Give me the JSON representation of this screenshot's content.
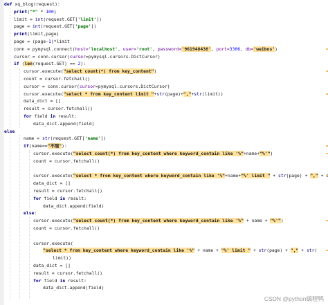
{
  "colors": {
    "background": "#ffffff",
    "keyword": "#000080",
    "string": "#007000",
    "number": "#0000ff",
    "highlight_box": "#ffe19c",
    "line_highlight": "#fffbe0",
    "watermark": "#9a9a9a"
  },
  "watermark": "CSDN @python编程鸭",
  "lines": [
    {
      "indent": 0,
      "tokens": [
        {
          "t": "def ",
          "c": "kw"
        },
        {
          "t": "xq_blog",
          "c": "fn"
        },
        {
          "t": "(request):",
          "c": "plain"
        }
      ]
    },
    {
      "indent": 1,
      "tokens": [
        {
          "t": "print",
          "c": "kw"
        },
        {
          "t": "(",
          "c": "plain"
        },
        {
          "t": "\"*\"",
          "c": "str"
        },
        {
          "t": " * ",
          "c": "plain"
        },
        {
          "t": "100",
          "c": "num"
        },
        {
          "t": ")",
          "c": "plain"
        }
      ]
    },
    {
      "indent": 1,
      "tokens": [
        {
          "t": "limit = ",
          "c": "plain"
        },
        {
          "t": "int",
          "c": "bi"
        },
        {
          "t": "(request.GET[",
          "c": "plain"
        },
        {
          "t": "'limit'",
          "c": "str"
        },
        {
          "t": "])",
          "c": "plain"
        }
      ]
    },
    {
      "indent": 1,
      "tokens": [
        {
          "t": "page = ",
          "c": "plain"
        },
        {
          "t": "int",
          "c": "bi"
        },
        {
          "t": "(request.GET[",
          "c": "plain"
        },
        {
          "t": "'page'",
          "c": "str"
        },
        {
          "t": "])",
          "c": "plain"
        }
      ]
    },
    {
      "indent": 1,
      "tokens": [
        {
          "t": "print",
          "c": "kw"
        },
        {
          "t": "(limit,page)",
          "c": "plain"
        }
      ]
    },
    {
      "indent": 1,
      "tokens": [
        {
          "t": "page = (page-",
          "c": "plain"
        },
        {
          "t": "1",
          "c": "num"
        },
        {
          "t": ")*limit",
          "c": "plain"
        }
      ]
    },
    {
      "indent": 1,
      "tokens": [
        {
          "t": "conn = pymysql.connect(",
          "c": "plain"
        },
        {
          "t": "host=",
          "c": "param"
        },
        {
          "t": "'localhost'",
          "c": "str"
        },
        {
          "t": ", ",
          "c": "plain"
        },
        {
          "t": "user=",
          "c": "param"
        },
        {
          "t": "'root'",
          "c": "str"
        },
        {
          "t": ", ",
          "c": "plain"
        },
        {
          "t": "password=",
          "c": "param"
        },
        {
          "t": "'961948438'",
          "c": "box"
        },
        {
          "t": ", ",
          "c": "plain"
        },
        {
          "t": "port=",
          "c": "param"
        },
        {
          "t": "3306",
          "c": "num"
        },
        {
          "t": ", ",
          "c": "plain"
        },
        {
          "t": "db=",
          "c": "param"
        },
        {
          "t": "'weibos'",
          "c": "box"
        },
        {
          "t": ")",
          "c": "plain"
        }
      ]
    },
    {
      "indent": 1,
      "tokens": [
        {
          "t": "cursor = conn.cursor(",
          "c": "plain"
        },
        {
          "t": "cursor",
          "c": "param"
        },
        {
          "t": "=pymysql.cursors.DictCursor)",
          "c": "plain"
        }
      ]
    },
    {
      "indent": 1,
      "tokens": [
        {
          "t": "if ",
          "c": "kw"
        },
        {
          "t": "(",
          "c": "plain"
        },
        {
          "t": "len",
          "c": "box"
        },
        {
          "t": "(request.GET) == ",
          "c": "plain"
        },
        {
          "t": "2",
          "c": "num"
        },
        {
          "t": "):",
          "c": "plain"
        }
      ]
    },
    {
      "indent": 2,
      "tokens": [
        {
          "t": "cursor.execute(",
          "c": "plain"
        },
        {
          "t": "\"select count(*) from key_content\"",
          "c": "box"
        },
        {
          "t": ")",
          "c": "plain"
        }
      ]
    },
    {
      "indent": 2,
      "tokens": [
        {
          "t": "count = cursor.fetchall()",
          "c": "plain"
        }
      ]
    },
    {
      "indent": 2,
      "tokens": [
        {
          "t": "cursor = conn.cursor(",
          "c": "plain"
        },
        {
          "t": "cursor",
          "c": "param"
        },
        {
          "t": "=pymysql.cursors.DictCursor)",
          "c": "plain"
        }
      ]
    },
    {
      "indent": 2,
      "tokens": [
        {
          "t": "cursor.execute(",
          "c": "plain"
        },
        {
          "t": "\"select * from key_content limit \"",
          "c": "box"
        },
        {
          "t": "+",
          "c": "plain"
        },
        {
          "t": "str",
          "c": "bi"
        },
        {
          "t": "(page)+",
          "c": "plain"
        },
        {
          "t": "\",\"",
          "c": "box"
        },
        {
          "t": "+",
          "c": "plain"
        },
        {
          "t": "str",
          "c": "bi"
        },
        {
          "t": "(limit))",
          "c": "plain"
        }
      ]
    },
    {
      "indent": 2,
      "tokens": [
        {
          "t": "data_dict = []",
          "c": "plain"
        }
      ]
    },
    {
      "indent": 2,
      "tokens": [
        {
          "t": "result = cursor.fetchall()",
          "c": "plain"
        }
      ]
    },
    {
      "indent": 2,
      "tokens": [
        {
          "t": "for ",
          "c": "kw"
        },
        {
          "t": "field ",
          "c": "plain"
        },
        {
          "t": "in ",
          "c": "kw"
        },
        {
          "t": "result:",
          "c": "plain"
        }
      ]
    },
    {
      "indent": 3,
      "tokens": [
        {
          "t": "data_dict.append(field)",
          "c": "plain"
        }
      ]
    },
    {
      "indent": 0,
      "tokens": [
        {
          "t": "else",
          "c": "kw"
        }
      ]
    },
    {
      "indent": 2,
      "tokens": [
        {
          "t": "name = ",
          "c": "plain"
        },
        {
          "t": "str",
          "c": "bi"
        },
        {
          "t": "(request.GET[",
          "c": "plain"
        },
        {
          "t": "'name'",
          "c": "str"
        },
        {
          "t": "])",
          "c": "plain"
        }
      ]
    },
    {
      "indent": 2,
      "tokens": [
        {
          "t": "if",
          "c": "kw"
        },
        {
          "t": "(name==",
          "c": "plain"
        },
        {
          "t": "\"不限\"",
          "c": "box"
        },
        {
          "t": "):",
          "c": "plain"
        }
      ]
    },
    {
      "indent": 3,
      "tokens": [
        {
          "t": "cursor.execute(",
          "c": "plain"
        },
        {
          "t": "\"select count(*) from key_content where keyword_contain like '%\"",
          "c": "box"
        },
        {
          "t": "+name+",
          "c": "plain"
        },
        {
          "t": "\"%'\"",
          "c": "box"
        },
        {
          "t": ")",
          "c": "plain"
        }
      ]
    },
    {
      "indent": 3,
      "tokens": [
        {
          "t": "count = cursor.fetchall()",
          "c": "plain"
        }
      ]
    },
    {
      "indent": 0,
      "tokens": []
    },
    {
      "indent": 3,
      "tokens": [
        {
          "t": "cursor.execute(",
          "c": "plain"
        },
        {
          "t": "\"select * from key_content where keyword_contain like '%\"",
          "c": "box"
        },
        {
          "t": "+name+",
          "c": "plain"
        },
        {
          "t": "\"%' limit \"",
          "c": "box"
        },
        {
          "t": " + ",
          "c": "plain"
        },
        {
          "t": "str",
          "c": "bi"
        },
        {
          "t": "(page) + ",
          "c": "plain"
        },
        {
          "t": "\",\"",
          "c": "box"
        },
        {
          "t": " + ",
          "c": "plain"
        },
        {
          "t": "str",
          "c": "bi"
        },
        {
          "t": "(limit))",
          "c": "plain"
        }
      ]
    },
    {
      "indent": 3,
      "tokens": [
        {
          "t": "data_dict = []",
          "c": "plain"
        }
      ]
    },
    {
      "indent": 3,
      "tokens": [
        {
          "t": "result = cursor.fetchall()",
          "c": "plain"
        }
      ]
    },
    {
      "indent": 3,
      "tokens": [
        {
          "t": "for ",
          "c": "kw"
        },
        {
          "t": "field ",
          "c": "plain"
        },
        {
          "t": "in ",
          "c": "kw"
        },
        {
          "t": "result:",
          "c": "plain"
        }
      ]
    },
    {
      "indent": 4,
      "tokens": [
        {
          "t": "data_dict.append(field)",
          "c": "plain"
        }
      ]
    },
    {
      "indent": 2,
      "tokens": [
        {
          "t": "else",
          "c": "kw"
        },
        {
          "t": ":",
          "c": "plain"
        }
      ]
    },
    {
      "indent": 3,
      "tokens": [
        {
          "t": "cursor.execute(",
          "c": "plain"
        },
        {
          "t": "\"select count(*) from key_content where keyword_contain like '%\"",
          "c": "box"
        },
        {
          "t": " + name + ",
          "c": "plain"
        },
        {
          "t": "\"%'\"",
          "c": "box"
        },
        {
          "t": ")",
          "c": "plain"
        }
      ]
    },
    {
      "indent": 3,
      "tokens": [
        {
          "t": "count = cursor.fetchall()",
          "c": "plain"
        }
      ]
    },
    {
      "indent": 0,
      "tokens": []
    },
    {
      "indent": 3,
      "tokens": [
        {
          "t": "cursor.execute(",
          "c": "plain"
        }
      ]
    },
    {
      "indent": 4,
      "tokens": [
        {
          "t": "\"select * from key_content where keyword_contain like '%\"",
          "c": "box"
        },
        {
          "t": " + name + ",
          "c": "plain"
        },
        {
          "t": "\"%' limit \"",
          "c": "box"
        },
        {
          "t": " + ",
          "c": "plain"
        },
        {
          "t": "str",
          "c": "bi"
        },
        {
          "t": "(page) + ",
          "c": "plain"
        },
        {
          "t": "\",\"",
          "c": "box"
        },
        {
          "t": " + ",
          "c": "plain"
        },
        {
          "t": "str",
          "c": "bi"
        },
        {
          "t": "(",
          "c": "plain"
        }
      ]
    },
    {
      "indent": 5,
      "tokens": [
        {
          "t": "limit))",
          "c": "plain"
        }
      ]
    },
    {
      "indent": 3,
      "tokens": [
        {
          "t": "data_dict = []",
          "c": "plain"
        }
      ]
    },
    {
      "indent": 3,
      "tokens": [
        {
          "t": "result = cursor.fetchall()",
          "c": "plain"
        }
      ]
    },
    {
      "indent": 3,
      "tokens": [
        {
          "t": "for ",
          "c": "kw"
        },
        {
          "t": "field ",
          "c": "plain"
        },
        {
          "t": "in ",
          "c": "kw"
        },
        {
          "t": "result:",
          "c": "plain"
        }
      ]
    },
    {
      "indent": 4,
      "tokens": [
        {
          "t": "data_dict.append(field)",
          "c": "plain"
        }
      ]
    }
  ]
}
